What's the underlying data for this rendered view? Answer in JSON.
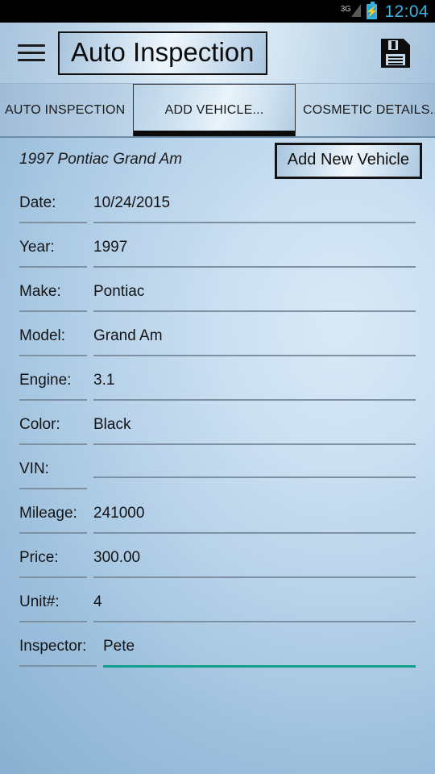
{
  "status_bar": {
    "network_label": "3G",
    "network_icon": "signal-bars-icon",
    "battery_icon": "battery-charging-icon",
    "time": "12:04",
    "time_color": "#33b5e5"
  },
  "action_bar": {
    "menu_icon": "hamburger-menu-icon",
    "title": "Auto Inspection",
    "save_icon": "floppy-save-icon"
  },
  "tabs": [
    {
      "label": "AUTO INSPECTION",
      "selected": false
    },
    {
      "label": "ADD VEHICLE...",
      "selected": true
    },
    {
      "label": "COSMETIC DETAILS...",
      "selected": false
    }
  ],
  "form": {
    "vehicle_title": "1997 Pontiac Grand Am",
    "add_new_vehicle_label": "Add New Vehicle",
    "focus_color": "#14a088",
    "fields": [
      {
        "label": "Date:",
        "value": "10/24/2015",
        "focused": false
      },
      {
        "label": "Year:",
        "value": "1997",
        "focused": false
      },
      {
        "label": "Make:",
        "value": "Pontiac",
        "focused": false
      },
      {
        "label": "Model:",
        "value": "Grand Am",
        "focused": false
      },
      {
        "label": "Engine:",
        "value": "3.1",
        "focused": false
      },
      {
        "label": "Color:",
        "value": "Black",
        "focused": false
      },
      {
        "label": "VIN:",
        "value": "",
        "focused": false
      },
      {
        "label": "Mileage:",
        "value": "241000",
        "focused": false
      },
      {
        "label": "Price:",
        "value": "300.00",
        "focused": false
      },
      {
        "label": "Unit#:",
        "value": "4",
        "focused": false
      },
      {
        "label": "Inspector:",
        "value": "Pete",
        "focused": true
      }
    ]
  }
}
